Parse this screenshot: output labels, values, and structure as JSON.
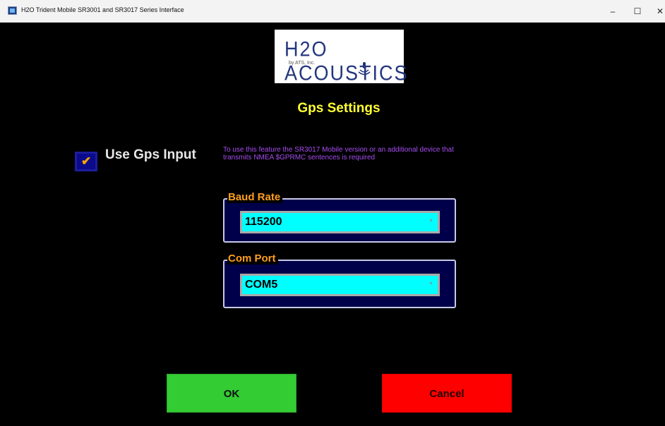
{
  "window": {
    "title": "H2O Trident Mobile SR3001 and SR3017 Series Interface",
    "minimize": "–",
    "maximize": "☐",
    "close": "✕"
  },
  "logo": {
    "text": "H2O ACOUSTICS",
    "subtitle": "by ATS, Inc."
  },
  "heading": "Gps Settings",
  "gps_input": {
    "label": "Use Gps Input",
    "checked": true,
    "hint": "To use this feature the SR3017 Mobile version or an additional device that transmits NMEA $GPRMC sentences is required"
  },
  "baud_rate": {
    "label": "Baud Rate",
    "value": "115200"
  },
  "com_port": {
    "label": "Com Port",
    "value": "COM5"
  },
  "buttons": {
    "ok": "OK",
    "cancel": "Cancel"
  },
  "colors": {
    "background": "#000000",
    "heading": "#ffff33",
    "hint": "#a64df0",
    "legend": "#ff9f1c",
    "combo": "#00ffff",
    "ok": "#33cc33",
    "cancel": "#ff0000"
  }
}
